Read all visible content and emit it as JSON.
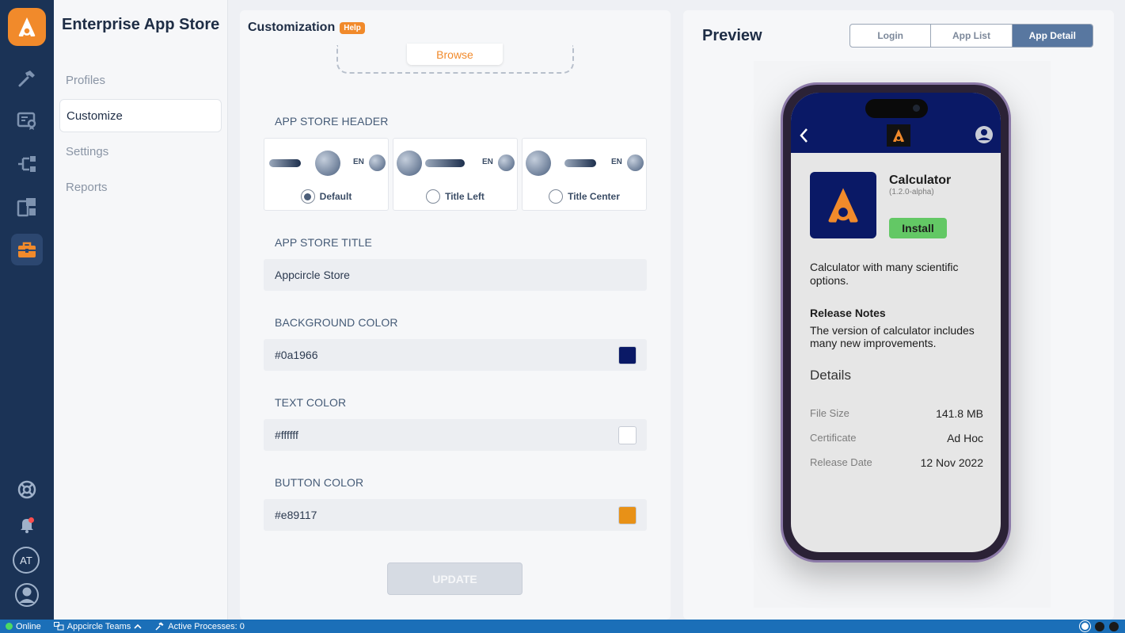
{
  "app": {
    "title": "Enterprise App Store"
  },
  "nav": {
    "items": [
      {
        "label": "Profiles"
      },
      {
        "label": "Customize"
      },
      {
        "label": "Settings"
      },
      {
        "label": "Reports"
      }
    ]
  },
  "rail": {
    "avatar_initials": "AT"
  },
  "customization": {
    "title": "Customization",
    "help_label": "Help",
    "browse_label": "Browse",
    "header_section_label": "APP STORE HEADER",
    "header_options": [
      {
        "label": "Default",
        "selected": true,
        "lang": "EN"
      },
      {
        "label": "Title Left",
        "selected": false,
        "lang": "EN"
      },
      {
        "label": "Title Center",
        "selected": false,
        "lang": "EN"
      }
    ],
    "title_label": "APP STORE TITLE",
    "title_value": "Appcircle Store",
    "bg_label": "BACKGROUND COLOR",
    "bg_value": "#0a1966",
    "text_label": "TEXT COLOR",
    "text_value": "#ffffff",
    "button_label": "BUTTON COLOR",
    "button_value": "#e89117",
    "update_label": "UPDATE"
  },
  "preview": {
    "title": "Preview",
    "tabs": [
      {
        "label": "Login",
        "active": false
      },
      {
        "label": "App List",
        "active": false
      },
      {
        "label": "App Detail",
        "active": true
      }
    ],
    "app_name": "Calculator",
    "app_version": "(1.2.0-alpha)",
    "install_label": "Install",
    "description": "Calculator with many scientific options.",
    "release_notes_title": "Release Notes",
    "release_notes": "The version of calculator includes many new improvements.",
    "details_title": "Details",
    "details": [
      {
        "key": "File Size",
        "value": "141.8 MB"
      },
      {
        "key": "Certificate",
        "value": "Ad Hoc"
      },
      {
        "key": "Release Date",
        "value": "12 Nov 2022"
      }
    ]
  },
  "statusbar": {
    "online": "Online",
    "teams": "Appcircle Teams",
    "processes": "Active Processes: 0"
  },
  "colors": {
    "accent": "#f18a2b",
    "rail": "#1b3356",
    "status": "#1b6fb8",
    "install": "#63c865"
  }
}
